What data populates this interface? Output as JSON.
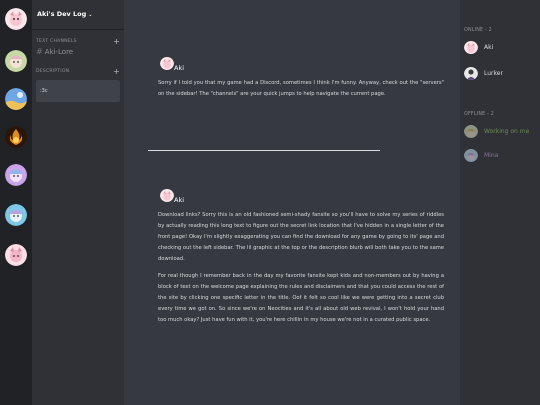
{
  "server_name": "Aki's Dev Log",
  "servers": [
    {
      "icon": "home-avatar-icon",
      "color": "#f3c9d0"
    },
    {
      "icon": "aki-avatar-icon",
      "color": "#c7d7a6"
    },
    {
      "icon": "sky-server-icon",
      "color": "#6fa6e6"
    },
    {
      "icon": "fire-server-icon",
      "color": "#e28a1c"
    },
    {
      "icon": "purple-server-icon",
      "color": "#c9a4e8"
    },
    {
      "icon": "cyan-server-icon",
      "color": "#7ec7e6"
    },
    {
      "icon": "pink-server-icon",
      "color": "#f6b5c7"
    }
  ],
  "sidebar": {
    "text_channels_label": "TEXT CHANNELS",
    "channel": "Aki-Lore",
    "description_label": "DESCRIPTION",
    "description_text": ":3c"
  },
  "posts": [
    {
      "author": "Aki",
      "paragraphs": [
        "Sorry if I told you that my game had a Discord, sometimes I think I'm funny. Anyway, check out the \"servers\" on the sidebar! The \"channels\" are your quick jumps to help navigate the current page."
      ]
    },
    {
      "author": "Aki",
      "paragraphs": [
        "Download links? Sorry this is an old fashioned semi-shady fansite so you'll have to solve my series of riddles by actually reading this long text to figure out the secret link location that I've hidden in a single letter of the front page! Okay I'm slightly exaggerating you can find the download for any game by going to its' page and checking out the left sidebar. The lil graphic at the top or the description blurb will both take you to the same download.",
        "For real though I remember back in the day my favorite fansite kept kids and non-members out by having a block of text on the welcome page explaining the rules and disclaimers and that you could access the rest of the site by clicking one specific letter in the title. Oof it felt so cool like we were getting into a secret club every time we got on. So since we're on Neocities and it's all about old web revival, I won't hold your hand too much okay? Just have fun with it, you're here chillin in my house we're not in a curated public space."
      ]
    }
  ],
  "members": {
    "online_label": "ONLINE - 2",
    "offline_label": "OFFLINE - 2",
    "online": [
      {
        "name": "Aki",
        "color": "#ffffff"
      },
      {
        "name": "Lurker",
        "color": "#ffffff"
      }
    ],
    "offline": [
      {
        "name": "Working on me",
        "color": "#9bd36a"
      },
      {
        "name": "Mina",
        "color": "#c9a4e8"
      }
    ]
  },
  "colors": {
    "server_bar": "#202225",
    "sidebar": "#2f3136",
    "chat": "#36393f"
  }
}
